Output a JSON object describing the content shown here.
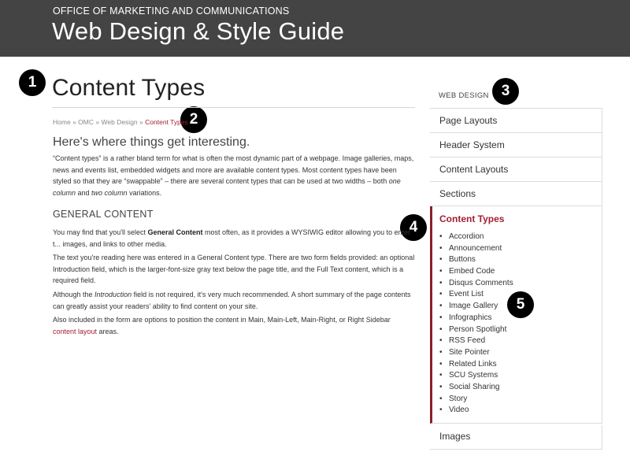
{
  "header": {
    "office": "OFFICE OF MARKETING AND COMMUNICATIONS",
    "site_title": "Web Design & Style Guide"
  },
  "markers": [
    "1",
    "2",
    "3",
    "4",
    "5"
  ],
  "main": {
    "page_title": "Content Types",
    "breadcrumb": {
      "items": [
        "Home",
        "OMC",
        "Web Design"
      ],
      "separator": "»",
      "current": "Content Types"
    },
    "intro": "Here's where things get interesting.",
    "paragraph_1": {
      "a": "“Content types” is a rather bland term for what is often the most dynamic part of a webpage. Image galleries, maps, news and events list, embedded widgets and more are available content types. Most content types have been styled so that they are “swappable” – there are several content types that can be used at two widths – both ",
      "em1": "one column",
      "b": " and ",
      "em2": "two column",
      "c": " variations."
    },
    "section_heading": "GENERAL CONTENT",
    "paragraph_2": {
      "a": "You may find that you'll select ",
      "strong": "General Content",
      "b": " most often, as it provides a WYSIWIG editor allowing you to enter t... images, and links to other media."
    },
    "paragraph_3": "The text you're reading here was entered in a General Content type. There are two form fields provided: an optional Introduction field, which is the larger-font-size gray text below the page title, and the Full Text content, which is a required field.",
    "paragraph_4": {
      "a": "Although the ",
      "em": "Introduction",
      "b": " field is not required, it's very much recommended. A short summary of the page contents can greatly assist your readers' ability to find content on your site."
    },
    "paragraph_5": {
      "a": "Also included in the form are options to position the content in Main, Main-Left, Main-Right, or Right Sidebar ",
      "link": "content layout",
      "b": " areas."
    }
  },
  "sidebar": {
    "title": "WEB DESIGN",
    "items": [
      "Page Layouts",
      "Header System",
      "Content Layouts",
      "Sections"
    ],
    "active": {
      "label": "Content Types",
      "children": [
        "Accordion",
        "Announcement",
        "Buttons",
        "Embed Code",
        "Disqus Comments",
        "Event List",
        "Image Gallery",
        "Infographics",
        "Person Spotlight",
        "RSS Feed",
        "Site Pointer",
        "Related Links",
        "SCU Systems",
        "Social Sharing",
        "Story",
        "Video"
      ]
    },
    "after": "Images"
  },
  "colors": {
    "header_bg": "#444444",
    "accent": "#a31f34",
    "active_border": "#8b1e2d"
  }
}
